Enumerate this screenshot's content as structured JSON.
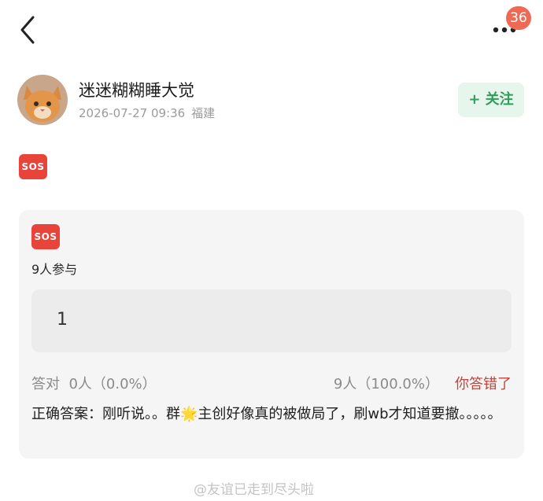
{
  "topbar": {
    "badge_count": "36",
    "back_icon": "chevron-left-icon",
    "more_icon": "more-dots-icon"
  },
  "post": {
    "username": "迷迷糊糊睡大觉",
    "time": "2026-07-27 09:36",
    "location": "福建",
    "follow_label": "+ 关注",
    "sos_label": "SOS"
  },
  "quiz": {
    "sos_label": "SOS",
    "participants": "9人参与",
    "option": "1",
    "correct_label": "答对",
    "correct_stats": "0人（0.0%）",
    "wrong_stats": "9人（100.0%）",
    "result": "你答错了",
    "answer": "正确答案：刚听说。。群🌟主创好像真的被做局了，刷wb才知道要撤。。。。。"
  },
  "watermark": "@友谊已走到尽头啦",
  "colors": {
    "follow": "#2f9e5b",
    "wrong": "#c0463c",
    "badge": "#ee6a55",
    "sos": "#e8443a"
  }
}
